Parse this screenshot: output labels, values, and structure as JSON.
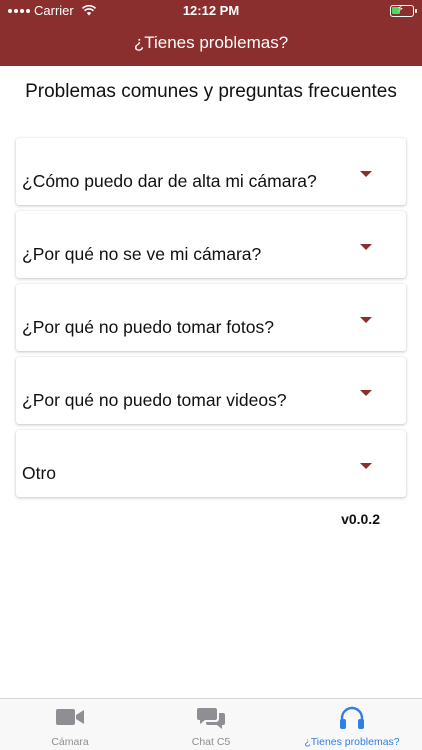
{
  "status_bar": {
    "carrier": "Carrier",
    "time": "12:12 PM"
  },
  "nav": {
    "title": "¿Tienes problemas?"
  },
  "section": {
    "title": "Problemas comunes y preguntas frecuentes"
  },
  "faq": [
    {
      "question": "¿Cómo puedo dar de alta mi cámara?"
    },
    {
      "question": "¿Por qué no se ve mi cámara?"
    },
    {
      "question": "¿Por qué no puedo tomar fotos?"
    },
    {
      "question": "¿Por qué no puedo tomar videos?"
    },
    {
      "question": "Otro"
    }
  ],
  "version": "v0.0.2",
  "tabs": [
    {
      "label": "Cámara",
      "icon": "video-camera-icon",
      "active": false
    },
    {
      "label": "Chat C5",
      "icon": "chat-bubbles-icon",
      "active": false
    },
    {
      "label": "¿Tienes problemas?",
      "icon": "headphones-icon",
      "active": true
    }
  ],
  "colors": {
    "brand": "#8b2e2e",
    "active_tab": "#2f7ee6",
    "inactive_tab": "#8e8e93"
  }
}
